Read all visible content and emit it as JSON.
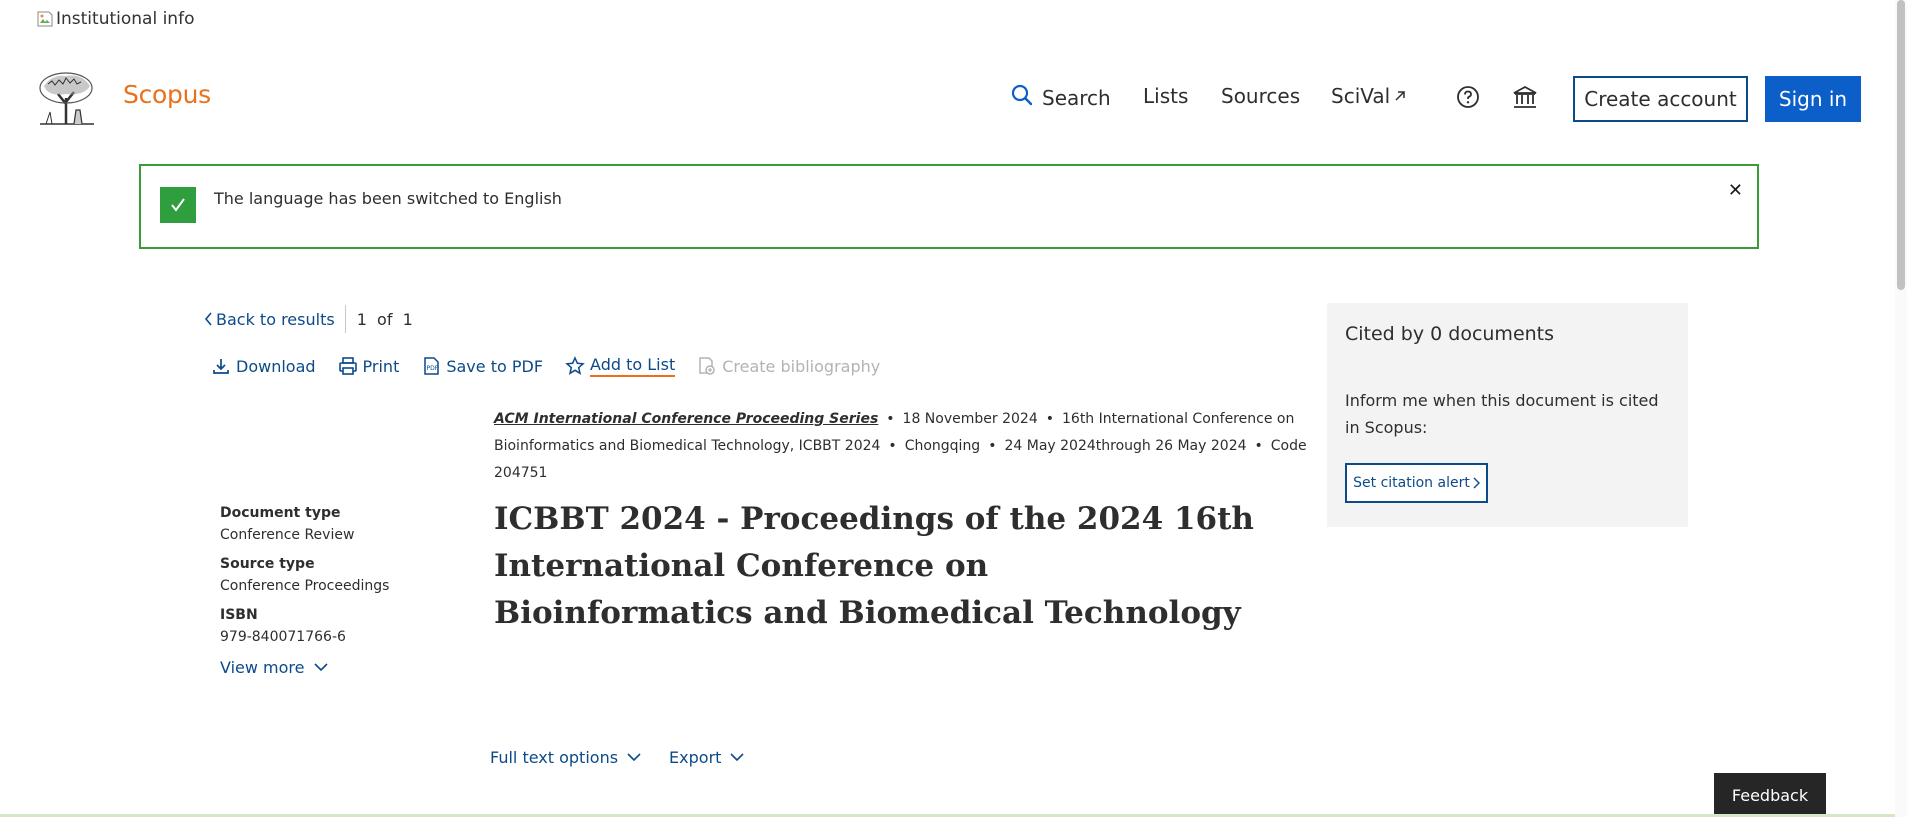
{
  "top": {
    "institutional_info_alt": "Institutional info"
  },
  "header": {
    "brand": "Scopus",
    "nav": {
      "search": "Search",
      "lists": "Lists",
      "sources": "Sources",
      "scival": "SciVal"
    },
    "create_account": "Create account",
    "sign_in": "Sign in",
    "icons": [
      "search-icon",
      "external-link-icon",
      "help-icon",
      "institution-icon"
    ]
  },
  "banner": {
    "message": "The language has been switched to English"
  },
  "nav_row": {
    "back": "Back to results",
    "pager": "1  of  1"
  },
  "actions": {
    "download": "Download",
    "print": "Print",
    "save_pdf": "Save to PDF",
    "add_list": "Add to List",
    "create_bibliography": "Create bibliography"
  },
  "source": {
    "series": "ACM International Conference Proceeding Series",
    "date": "18 November 2024",
    "conference": "16th International Conference on Bioinformatics and Biomedical Technology, ICBBT 2024",
    "location": "Chongqing",
    "dates": "24 May 2024through 26 May 2024",
    "code": "Code 204751"
  },
  "document": {
    "title": "ICBBT 2024 - Proceedings of the 2024 16th International Conference on Bioinformatics and Biomedical Technology"
  },
  "meta": {
    "doc_type_label": "Document type",
    "doc_type": "Conference Review",
    "source_type_label": "Source type",
    "source_type": "Conference Proceedings",
    "isbn_label": "ISBN",
    "isbn": "979-840071766-6",
    "view_more": "View more"
  },
  "bottom": {
    "full_text": "Full text options",
    "export": "Export"
  },
  "cited": {
    "title": "Cited by 0 documents",
    "desc": "Inform me when this document is cited in Scopus:",
    "button": "Set citation alert"
  },
  "feedback": "Feedback",
  "colors": {
    "brand": "#e9711c",
    "link": "#0c4a8a",
    "primary": "#0c5ec8",
    "success": "#2e9e3e"
  }
}
